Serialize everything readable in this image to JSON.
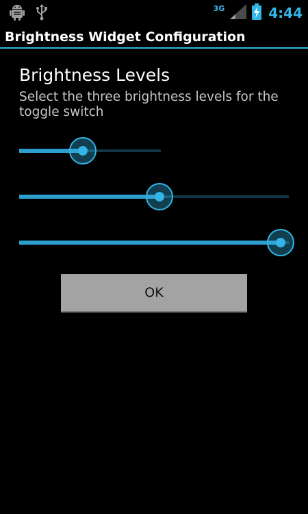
{
  "status_bar": {
    "network_type": "3G",
    "time": "4:44",
    "icons": [
      "android-debug-icon",
      "usb-icon",
      "signal-icon",
      "battery-charging-icon"
    ]
  },
  "title_bar": {
    "title": "Brightness Widget Configuration"
  },
  "content": {
    "heading": "Brightness Levels",
    "description": "Select the three brightness levels for the toggle switch",
    "sliders": [
      {
        "name": "brightness-level-1",
        "value_fraction": 0.45
      },
      {
        "name": "brightness-level-2",
        "value_fraction": 0.52
      },
      {
        "name": "brightness-level-3",
        "value_fraction": 0.97
      }
    ],
    "ok_label": "OK"
  },
  "colors": {
    "accent": "#33b5e5",
    "background": "#000000",
    "button": "#a3a3a3"
  }
}
